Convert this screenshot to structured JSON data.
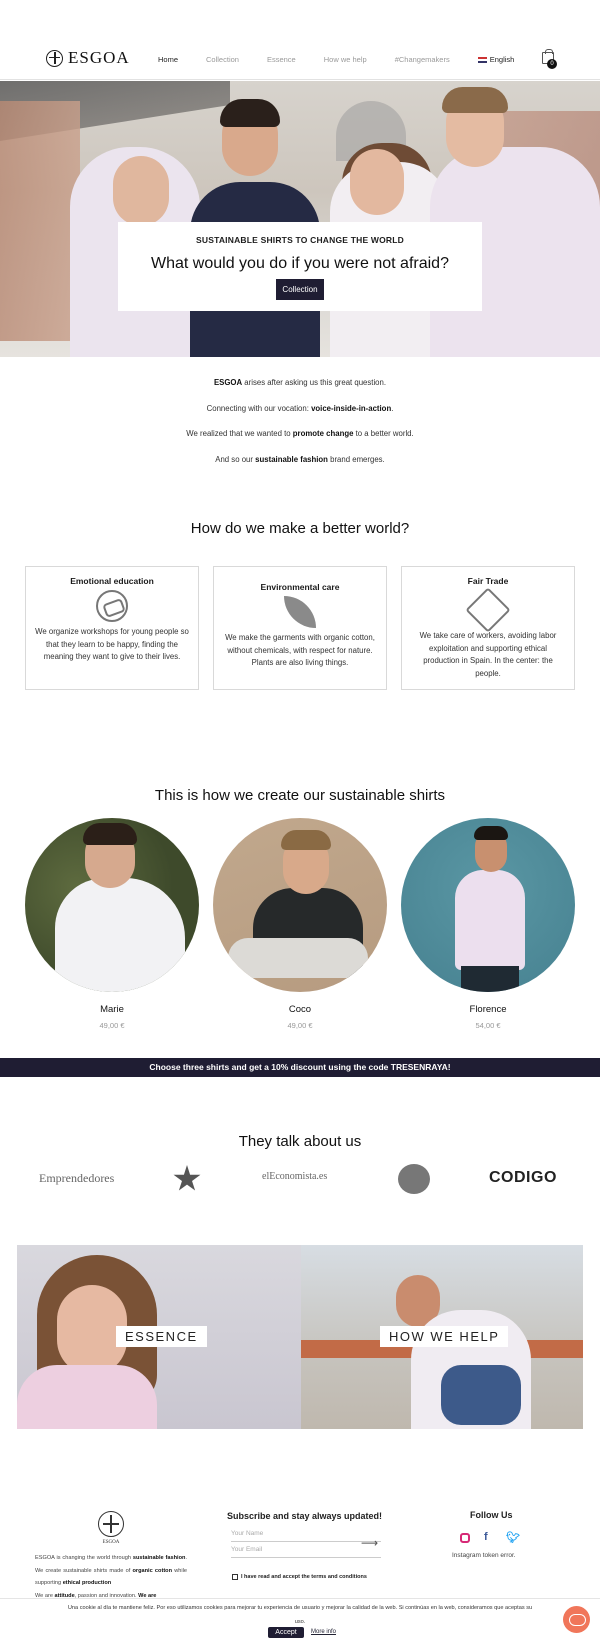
{
  "header": {
    "brand": "ESGOA",
    "nav": [
      "Home",
      "Collection",
      "Essence",
      "How we help",
      "#Changemakers"
    ],
    "language": "English",
    "cart_count": "0"
  },
  "hero": {
    "kicker": "SUSTAINABLE SHIRTS TO CHANGE THE WORLD",
    "title": "What would you do if you were not afraid?",
    "button": "Collection"
  },
  "intro": {
    "l1_b": "ESGOA",
    "l1_rest": " arises after asking us this great question.",
    "l2_pre": "Connecting with our vocation: ",
    "l2_b": "voice-inside-in-action",
    "l2_post": ".",
    "l3_pre": "We realized that we wanted to ",
    "l3_b": "promote change",
    "l3_post": " to a better world.",
    "l4_pre": "And so our ",
    "l4_b": "sustainable fashion",
    "l4_post": " brand emerges."
  },
  "better_world": {
    "title": "How do we make a better world?",
    "cards": [
      {
        "title": "Emotional education",
        "text": "We organize workshops for young people so that they learn to be happy, finding the meaning they want to give to their lives.",
        "icon": "hands-heart-icon"
      },
      {
        "title": "Environmental care",
        "text": "We make the garments with organic cotton, without chemicals, with respect for nature. Plants are also living things.",
        "icon": "leaf-icon"
      },
      {
        "title": "Fair Trade",
        "text": "We take care of workers, avoiding labor exploitation and supporting ethical production in Spain. In the center: the people.",
        "icon": "handshake-icon"
      }
    ]
  },
  "shirts": {
    "title": "This is how we create our sustainable shirts",
    "products": [
      {
        "name": "Marie",
        "price": "49,00 €"
      },
      {
        "name": "Coco",
        "price": "49,00 €"
      },
      {
        "name": "Florence",
        "price": "54,00 €"
      }
    ]
  },
  "banner": "Choose three shirts and get a 10% discount using the code TRESENRAYA!",
  "press": {
    "title": "They talk about us",
    "logos": [
      "Emprendedores",
      "elEconomista.es",
      "CODIGO"
    ]
  },
  "tiles": {
    "left": "ESSENCE",
    "right": "HOW WE HELP"
  },
  "footer": {
    "logo_word": "ESGOA",
    "about_1": "ESGOA is changing the world through ",
    "about_b1": "sustainable fashion",
    "about_2": ". We create sustainable shirts made of ",
    "about_b2": "organic cotton",
    "about_3": " while supporting ",
    "about_b3": "ethical production",
    "about_4": "We are ",
    "about_b4": "attitude",
    "about_5": ", passion and innovation. ",
    "about_b5": "We are",
    "subscribe_title": "Subscribe and stay always updated!",
    "name_placeholder": "Your Name",
    "email_placeholder": "Your Email",
    "terms": "I have read and accept the terms and conditions",
    "follow_title": "Follow Us",
    "instagram_error": "Instagram token error."
  },
  "cookie": {
    "text": "Una cookie al día te mantiene feliz. Por eso utilizamos cookies para mejorar tu experiencia de usuario y mejorar la calidad de la web. Si continúas en la web, consideramos que aceptas su",
    "text2": "uso.",
    "accept": "Accept",
    "more": "More info"
  }
}
